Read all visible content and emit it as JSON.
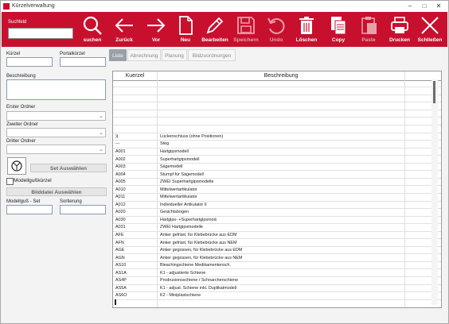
{
  "window": {
    "title": "Kürzelverwaltung",
    "minimize": "–",
    "maximize": "□",
    "close": "✕"
  },
  "toolbar": {
    "search_label": "Suchfeld",
    "search_value": "",
    "buttons": [
      {
        "label": "suchen",
        "icon": "search-icon"
      },
      {
        "label": "Zurück",
        "icon": "arrow-left-icon"
      },
      {
        "label": "Vor",
        "icon": "arrow-right-icon"
      },
      {
        "label": "Neu",
        "icon": "new-document-icon"
      },
      {
        "label": "Bearbeiten",
        "icon": "pencil-icon"
      },
      {
        "label": "Speichern",
        "icon": "floppy-disk-icon"
      },
      {
        "label": "Undo",
        "icon": "undo-icon"
      },
      {
        "label": "Löschen",
        "icon": "trash-icon"
      },
      {
        "label": "Copy",
        "icon": "copy-icon"
      },
      {
        "label": "Paste",
        "icon": "paste-icon"
      },
      {
        "label": "Drucken",
        "icon": "printer-icon"
      },
      {
        "label": "Schließen",
        "icon": "close-x-icon"
      }
    ]
  },
  "form": {
    "kuerzel_label": "Kürzel",
    "portalkuerzel_label": "Portalkürzel",
    "beschreibung_label": "Beschreibung",
    "erster_ordner_label": "Erster Ordner",
    "zweiter_ordner_label": "Zweiter Ordner",
    "dritter_ordner_label": "Dritter Ordner",
    "set_auswaehlen": "Set Auswählen",
    "modellguss_checkbox": "Modellgußkürzel",
    "bilddatei_button": "Bilddatei Auswählen",
    "modellguss_set_label": "Modellguß - Set",
    "sortierung_label": "Sortierung"
  },
  "tabs": [
    "Liste",
    "Abrechnung",
    "Planung",
    "Bildzuordnungen"
  ],
  "grid": {
    "col_kuerzel": "Kuerzel",
    "col_beschreibung": "Beschreibung",
    "rows": [
      {
        "k": "",
        "b": ""
      },
      {
        "k": "",
        "b": ""
      },
      {
        "k": "",
        "b": ""
      },
      {
        "k": "",
        "b": ""
      },
      {
        "k": "",
        "b": ""
      },
      {
        "k": "",
        "b": ""
      },
      {
        "k": "",
        "b": ""
      },
      {
        "k": ")(",
        "b": "Lückenschluss (ohne Positionen)"
      },
      {
        "k": "---",
        "b": "Steg"
      },
      {
        "k": "A001",
        "b": "Hartgipsmodell"
      },
      {
        "k": "A002",
        "b": "Superhartgipsmodell"
      },
      {
        "k": "A003",
        "b": "Sägemodell"
      },
      {
        "k": "A004",
        "b": "Stumpf für Sägemodell"
      },
      {
        "k": "A005",
        "b": "ZWEI Superhartgipsmodelle"
      },
      {
        "k": "A010",
        "b": "Mittelwertartikulator"
      },
      {
        "k": "A011",
        "b": "Mittelwertartikulator"
      },
      {
        "k": "A012",
        "b": "Individueller Artikulator II"
      },
      {
        "k": "A020",
        "b": "Gesichtsbogen"
      },
      {
        "k": "A030",
        "b": "Hartgips- +Superhartgipsmod."
      },
      {
        "k": "A031",
        "b": "ZWEI Hartgipsmodelle"
      },
      {
        "k": "AFE",
        "b": "Anker gefräst, für Klebebrücke aus EDM"
      },
      {
        "k": "AFN",
        "b": "Anker gefräst, für Klebebrücke aus NEM"
      },
      {
        "k": "AGE",
        "b": "Anker gegossen, für Klebebrücke aus EDM"
      },
      {
        "k": "AGN",
        "b": "Anker gegossen, für Klebebrücke aus NEM"
      },
      {
        "k": "AS10",
        "b": "Bleachingschiene Medikamentensch."
      },
      {
        "k": "AS1A",
        "b": "K1 - adjustierte Schiene"
      },
      {
        "k": "AS4P",
        "b": "Prodrusionsschiene / Schnarcherschiene"
      },
      {
        "k": "AS5A",
        "b": "K1 - adjust. Schiene inkl. Duplikatmodell"
      },
      {
        "k": "AS6O",
        "b": "K2 - Miniplastschiene"
      }
    ]
  }
}
